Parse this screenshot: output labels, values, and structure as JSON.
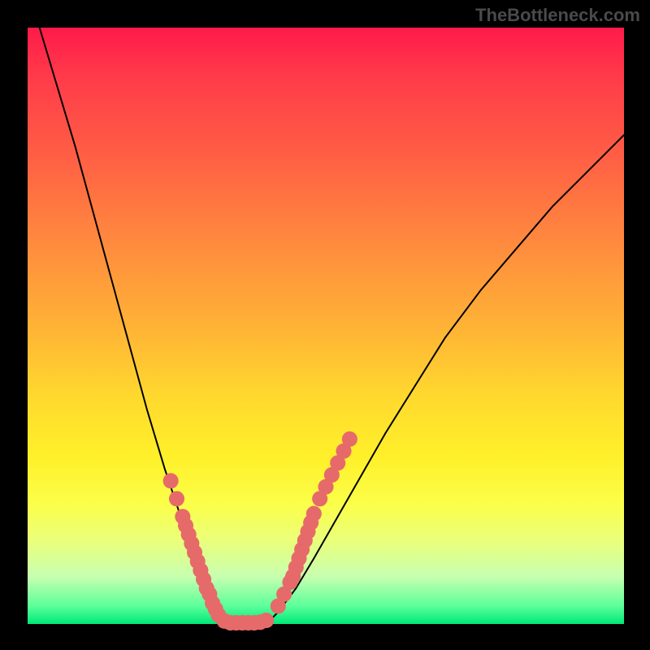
{
  "watermark": "TheBottleneck.com",
  "chart_data": {
    "type": "line",
    "title": "",
    "xlabel": "",
    "ylabel": "",
    "xlim": [
      0,
      100
    ],
    "ylim": [
      0,
      100
    ],
    "series": [
      {
        "name": "curve-left",
        "x": [
          2,
          5,
          8,
          11,
          14,
          17,
          20,
          23,
          26,
          29,
          31,
          32.5,
          34
        ],
        "y": [
          100,
          90,
          80,
          69,
          58,
          47,
          36,
          26,
          17,
          9,
          4,
          1.5,
          0
        ]
      },
      {
        "name": "curve-right",
        "x": [
          40,
          42,
          45,
          48,
          52,
          56,
          60,
          65,
          70,
          76,
          82,
          88,
          94,
          100
        ],
        "y": [
          0,
          2,
          6,
          11,
          18,
          25,
          32,
          40,
          48,
          56,
          63,
          70,
          76,
          82
        ]
      },
      {
        "name": "marker-band-left",
        "x": [
          24,
          25,
          26,
          26.5,
          27,
          27.5,
          28,
          28.5,
          29,
          29.5,
          30,
          30.5,
          31,
          31.5,
          32
        ],
        "y": [
          24,
          21,
          18,
          16.5,
          15,
          13.5,
          12,
          10.5,
          9,
          7.5,
          6,
          5,
          3.5,
          2.5,
          1.5
        ]
      },
      {
        "name": "marker-band-right",
        "x": [
          42,
          43,
          44,
          44.5,
          45,
          45.5,
          46,
          46.5,
          47,
          47.5,
          48,
          49,
          50,
          51,
          52,
          53,
          54
        ],
        "y": [
          3,
          5,
          7,
          8,
          9.5,
          11,
          12.5,
          14,
          15.5,
          17,
          18.5,
          21,
          23,
          25,
          27,
          29,
          31
        ]
      },
      {
        "name": "floor-band",
        "x": [
          33,
          34,
          35,
          36,
          37,
          38,
          39,
          40
        ],
        "y": [
          0.5,
          0.2,
          0.2,
          0.2,
          0.2,
          0.2,
          0.3,
          0.6
        ]
      }
    ],
    "marker_color": "#e66a6a",
    "marker_radius_frac": 0.013,
    "curve_color": "#000000",
    "curve_width": 2
  }
}
